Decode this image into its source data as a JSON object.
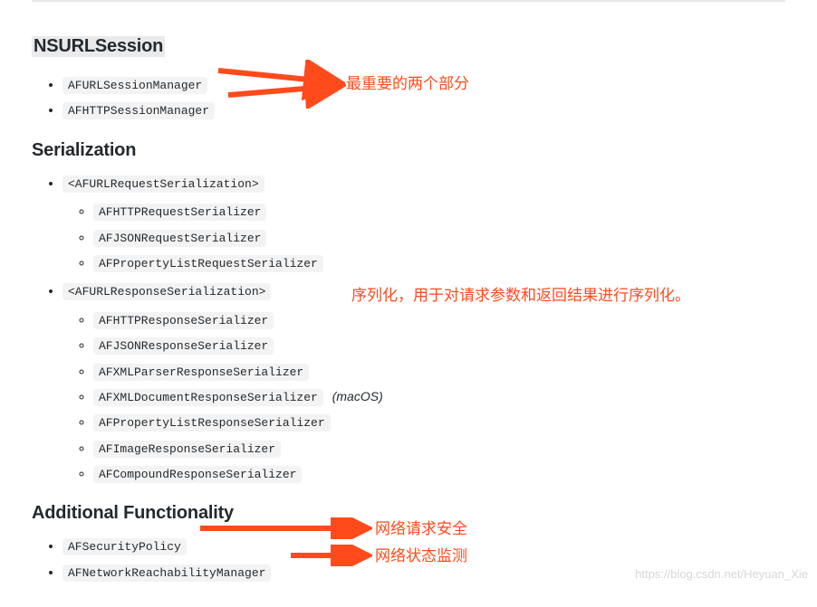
{
  "sections": {
    "s1": {
      "title": "NSURLSession",
      "items": [
        "AFURLSessionManager",
        "AFHTTPSessionManager"
      ]
    },
    "s2": {
      "title": "Serialization",
      "group1": {
        "head": "<AFURLRequestSerialization>",
        "children": [
          "AFHTTPRequestSerializer",
          "AFJSONRequestSerializer",
          "AFPropertyListRequestSerializer"
        ]
      },
      "group2": {
        "head": "<AFURLResponseSerialization>",
        "children": [
          "AFHTTPResponseSerializer",
          "AFJSONResponseSerializer",
          "AFXMLParserResponseSerializer",
          "AFXMLDocumentResponseSerializer",
          "AFPropertyListResponseSerializer",
          "AFImageResponseSerializer",
          "AFCompoundResponseSerializer"
        ],
        "macos_note": "(macOS)"
      }
    },
    "s3": {
      "title": "Additional Functionality",
      "items": [
        "AFSecurityPolicy",
        "AFNetworkReachabilityManager"
      ]
    }
  },
  "annotations": {
    "a1": "最重要的两个部分",
    "a2": "序列化，用于对请求参数和返回结果进行序列化。",
    "a3": "网络请求安全",
    "a4": "网络状态监测"
  },
  "watermark": "https://blog.csdn.net/Heyuan_Xie"
}
